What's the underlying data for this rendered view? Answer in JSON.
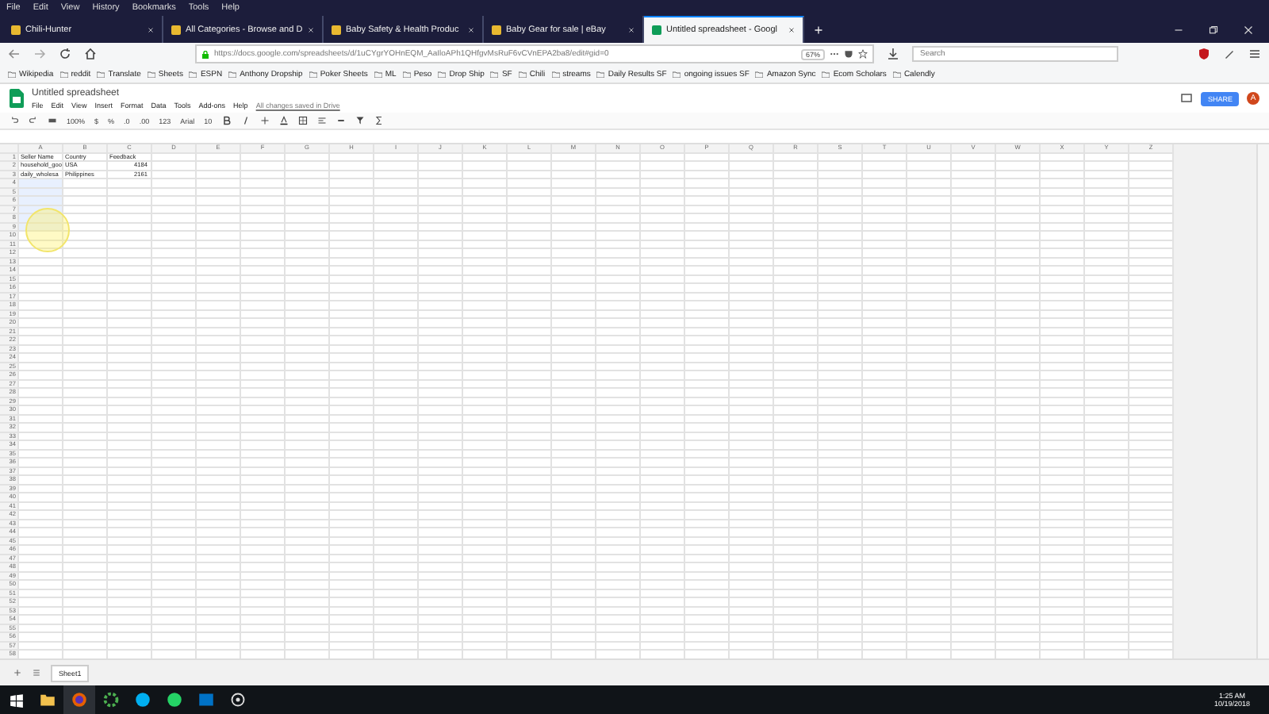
{
  "menu_bar": [
    "File",
    "Edit",
    "View",
    "History",
    "Bookmarks",
    "Tools",
    "Help"
  ],
  "tabs": [
    {
      "label": "Chili-Hunter",
      "selected": false
    },
    {
      "label": "All Categories - Browse and D",
      "selected": false
    },
    {
      "label": "Baby Safety & Health Produc",
      "selected": false
    },
    {
      "label": "Baby Gear for sale | eBay",
      "selected": false
    },
    {
      "label": "Untitled spreadsheet - Googl",
      "selected": true
    }
  ],
  "address_bar": {
    "url": "https://docs.google.com/spreadsheets/d/1uCYgrYOHnEQM_AaIloAPh1QHfgvMsRuF6vCVnEPA2ba8/edit#gid=0",
    "zoom": "67%"
  },
  "search": {
    "placeholder": "Search"
  },
  "bookmarks": [
    "Wikipedia",
    "reddit",
    "Translate",
    "Sheets",
    "ESPN",
    "Anthony Dropship",
    "Poker Sheets",
    "ML",
    "Peso",
    "Drop Ship",
    "SF",
    "Chili",
    "streams",
    "Daily Results SF",
    "ongoing issues SF",
    "Amazon Sync",
    "Ecom Scholars",
    "Calendly"
  ],
  "sheet": {
    "title": "Untitled spreadsheet",
    "menu": [
      "File",
      "Edit",
      "View",
      "Insert",
      "Format",
      "Data",
      "Tools",
      "Add-ons",
      "Help"
    ],
    "save_status": "All changes saved in Drive",
    "share": "SHARE",
    "avatar": "A",
    "toolbar": [
      "100%",
      "$",
      "%",
      ".0",
      ".00",
      "123",
      "Arial",
      "10"
    ],
    "columns": [
      "A",
      "B",
      "C",
      "D",
      "E",
      "F",
      "G",
      "H",
      "I",
      "J",
      "K",
      "L",
      "M",
      "N",
      "O",
      "P",
      "Q",
      "R",
      "S",
      "T",
      "U",
      "V",
      "W",
      "X",
      "Y",
      "Z"
    ],
    "rows": [
      [
        "Seller Name",
        "Country",
        "Feedback"
      ],
      [
        "household_goo",
        "USA",
        "4184"
      ],
      [
        "daily_wholesa",
        "Philippines",
        "2161"
      ]
    ],
    "row_numbers": [
      "1",
      "2",
      "3",
      "4",
      "5",
      "6",
      "7",
      "8",
      "9",
      "10",
      "11",
      "12",
      "13",
      "14",
      "15",
      "16",
      "17",
      "18",
      "19",
      "20",
      "21",
      "22",
      "23",
      "24",
      "25",
      "26",
      "27",
      "28",
      "29",
      "30",
      "31",
      "32",
      "33",
      "34",
      "35",
      "36",
      "37",
      "38",
      "39",
      "40",
      "41",
      "42",
      "43",
      "44",
      "45",
      "46",
      "47",
      "48",
      "49",
      "50",
      "51",
      "52",
      "53",
      "54",
      "55",
      "56",
      "57",
      "58"
    ],
    "sheet_tabs": [
      {
        "label": "Sheet1",
        "selected": true
      }
    ]
  },
  "taskbar": {
    "time": "1:25 AM",
    "date": "10/19/2018"
  }
}
